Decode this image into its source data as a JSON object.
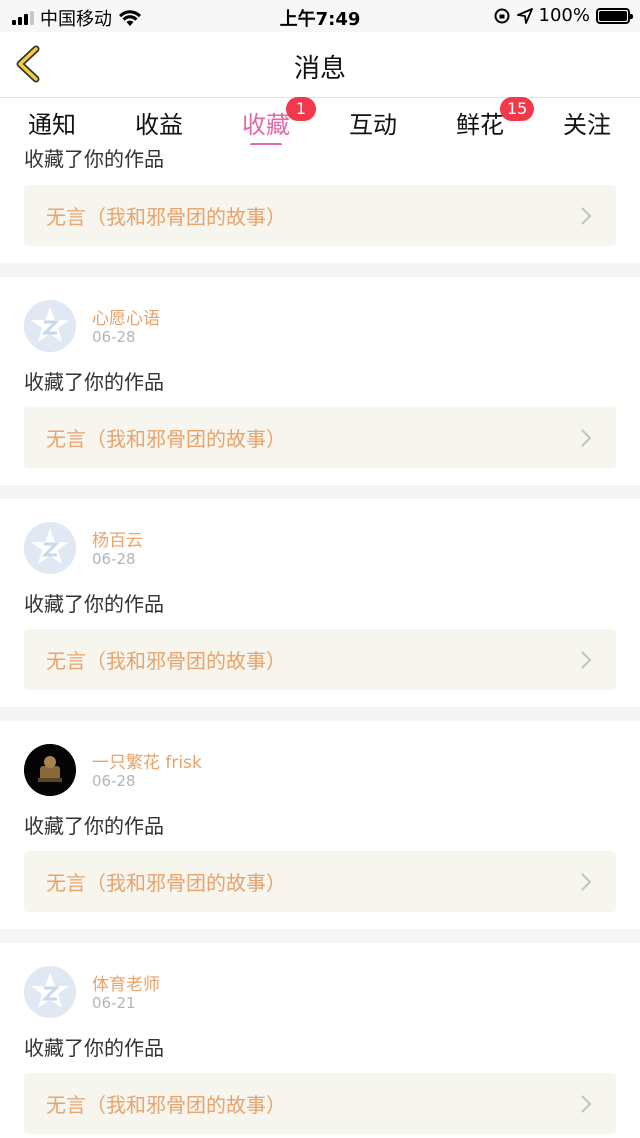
{
  "status_bar": {
    "carrier": "中国移动",
    "time": "上午7:49",
    "battery": "100%",
    "battery_level": 1.0
  },
  "nav": {
    "title": "消息",
    "back_icon": "chevron-left-icon"
  },
  "tabs": [
    {
      "label": "通知",
      "badge": null,
      "active": false
    },
    {
      "label": "收益",
      "badge": null,
      "active": false
    },
    {
      "label": "收藏",
      "badge": "1",
      "active": true
    },
    {
      "label": "互动",
      "badge": null,
      "active": false
    },
    {
      "label": "鲜花",
      "badge": "15",
      "active": false
    },
    {
      "label": "关注",
      "badge": null,
      "active": false
    }
  ],
  "colors": {
    "accent": "#e06aa8",
    "badge": "#f2394b",
    "username": "#e9a36b",
    "card_bg": "#f6f5ee"
  },
  "top_partial": {
    "action": "收藏了你的作品",
    "work": "无言（我和邪骨团的故事）"
  },
  "items": [
    {
      "name": "心愿心语",
      "date": "06-28",
      "action": "收藏了你的作品",
      "work": "无言（我和邪骨团的故事）",
      "avatar": "default-avatar-icon"
    },
    {
      "name": "杨百云",
      "date": "06-28",
      "action": "收藏了你的作品",
      "work": "无言（我和邪骨团的故事）",
      "avatar": "default-avatar-icon"
    },
    {
      "name": "一只繁花 frisk",
      "date": "06-28",
      "action": "收藏了你的作品",
      "work": "无言（我和邪骨团的故事）",
      "avatar": "photo-avatar"
    },
    {
      "name": "体育老师",
      "date": "06-21",
      "action": "收藏了你的作品",
      "work": "无言（我和邪骨团的故事）",
      "avatar": "default-avatar-icon"
    }
  ]
}
